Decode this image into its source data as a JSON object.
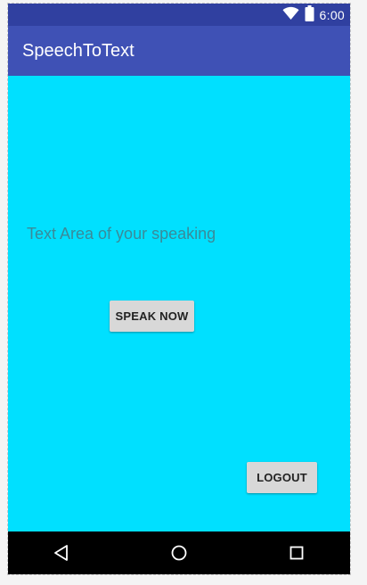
{
  "status_bar": {
    "time": "6:00",
    "icons": [
      "wifi-icon",
      "battery-icon"
    ]
  },
  "app_bar": {
    "title": "SpeechToText"
  },
  "main": {
    "speech_text": "Text Area of your speaking",
    "speak_button_label": "SPEAK NOW",
    "logout_button_label": "LOGOUT"
  },
  "nav_bar": {
    "icons": [
      "back-icon",
      "home-icon",
      "recents-icon"
    ]
  },
  "colors": {
    "status_bar": "#3040a0",
    "app_bar": "#3f51b5",
    "content_background": "#00e0ff",
    "button": "#d8d8d8",
    "nav_bar": "#000000"
  }
}
